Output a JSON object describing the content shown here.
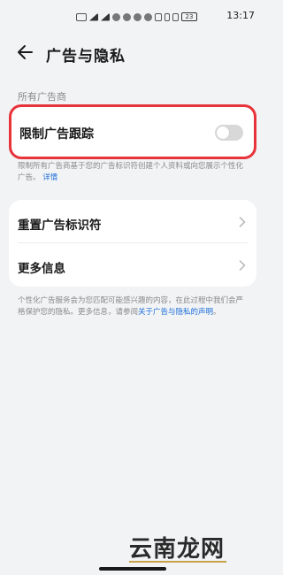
{
  "status_bar": {
    "time": "13:17",
    "battery": "23",
    "icons": [
      "notification-icon",
      "signal-icon",
      "signal-icon",
      "wifi-icon",
      "app-icon",
      "app-icon",
      "app-icon",
      "nfc-icon",
      "bluetooth-icon",
      "vibrate-icon",
      "battery-icon"
    ]
  },
  "header": {
    "back_icon": "arrow-left-icon",
    "title": "广告与隐私"
  },
  "section": {
    "label": "所有广告商"
  },
  "limit_tracking": {
    "label": "限制广告跟踪",
    "toggle_on": false,
    "description": "限制所有广告商基于您的广告标识符创建个人资料或向您展示个性化广告。",
    "link_text": "详情"
  },
  "options": [
    {
      "label": "重置广告标识符",
      "icon": "chevron-right-icon"
    },
    {
      "label": "更多信息",
      "icon": "chevron-right-icon"
    }
  ],
  "footer": {
    "text": "个性化广告服务会为您匹配可能感兴趣的内容，在此过程中我们会严格保护您的隐私。更多信息，请参阅",
    "link_text": "关于广告与隐私的声明",
    "suffix": "。"
  },
  "watermark": {
    "text": "云南龙网"
  },
  "colors": {
    "background": "#f1f3f5",
    "card": "#ffffff",
    "highlight_border": "#e8333a",
    "link": "#1e6fd9",
    "secondary_text": "#8a8a8a"
  }
}
